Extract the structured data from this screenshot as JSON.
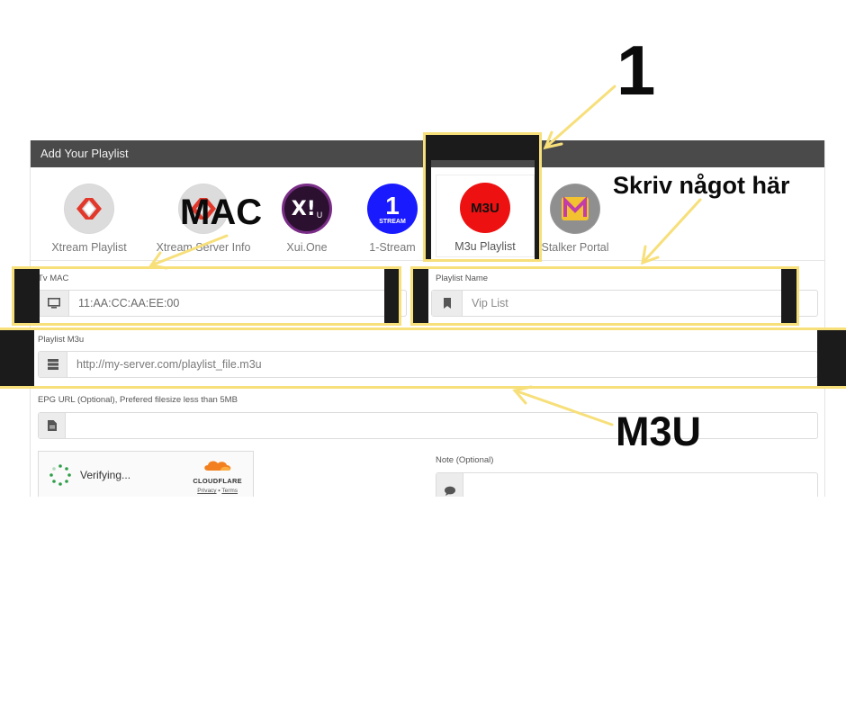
{
  "panel": {
    "title": "Add Your Playlist"
  },
  "tabs": [
    {
      "label": "Xtream Playlist",
      "icon": "xtream-icon"
    },
    {
      "label": "Xtream Server Info",
      "icon": "xtream-icon"
    },
    {
      "label": "Xui.One",
      "icon": "xui-one-icon",
      "logo_text": "X!",
      "logo_sub": "U"
    },
    {
      "label": "1-Stream",
      "icon": "one-stream-icon",
      "logo_text": "1",
      "logo_sub": "STREAM"
    },
    {
      "label": "M3u Playlist",
      "icon": "m3u-icon",
      "logo_text": "M3U",
      "active": true
    },
    {
      "label": "Stalker Portal",
      "icon": "stalker-icon",
      "logo_text": "M"
    }
  ],
  "form": {
    "tv_mac": {
      "label": "Tv MAC",
      "value": "11:AA:CC:AA:EE:00",
      "icon": "monitor-icon"
    },
    "playlist_name": {
      "label": "Playlist Name",
      "placeholder": "Vip List",
      "icon": "bookmark-icon"
    },
    "playlist_m3u": {
      "label": "Playlist M3u",
      "placeholder": "http://my-server.com/playlist_file.m3u",
      "icon": "server-icon"
    },
    "epg_url": {
      "label": "EPG URL (Optional), Prefered filesize less than 5MB",
      "value": "",
      "icon": "file-icon"
    },
    "note": {
      "label": "Note (Optional)",
      "value": "",
      "icon": "comment-icon"
    }
  },
  "captcha": {
    "status": "Verifying...",
    "brand": "CLOUDFLARE",
    "privacy": "Privacy",
    "separator": "•",
    "terms": "Terms"
  },
  "annotations": {
    "step": "1",
    "mac": "MAC",
    "write_here": "Skriv något här",
    "m3u": "M3U"
  },
  "colors": {
    "highlight": "#f7df7a",
    "header": "#4a4a4a",
    "m3u_logo": "#ee1111",
    "stream_logo": "#1a1aff"
  }
}
